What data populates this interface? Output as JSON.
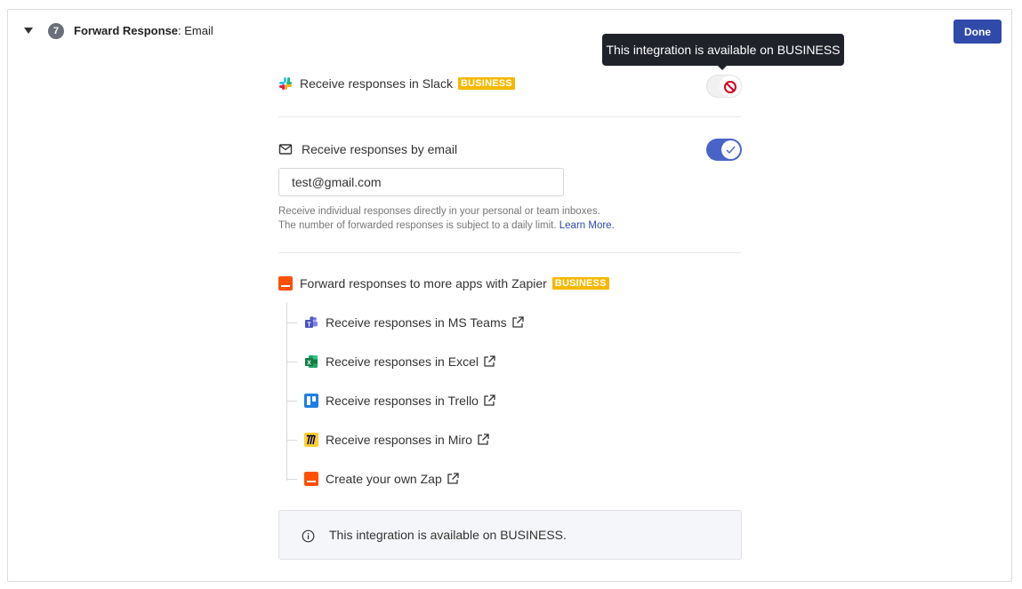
{
  "header": {
    "step_number": "7",
    "title_bold": "Forward Response",
    "title_rest": ": Email",
    "done_label": "Done"
  },
  "tooltip": {
    "text": "This integration is available on BUSINESS"
  },
  "slack": {
    "label": "Receive responses in Slack",
    "badge": "BUSINESS",
    "enabled": false
  },
  "email": {
    "label": "Receive responses by email",
    "enabled": true,
    "value": "test@gmail.com",
    "help_line1": "Receive individual responses directly in your personal or team inboxes.",
    "help_line2": "The number of forwarded responses is subject to a daily limit.",
    "learn_more": "Learn More."
  },
  "zapier": {
    "label": "Forward responses to more apps with Zapier",
    "badge": "BUSINESS",
    "items": [
      {
        "label": "Receive responses in MS Teams",
        "icon": "ms-teams-icon"
      },
      {
        "label": "Receive responses in Excel",
        "icon": "excel-icon"
      },
      {
        "label": "Receive responses in Trello",
        "icon": "trello-icon"
      },
      {
        "label": "Receive responses in Miro",
        "icon": "miro-icon"
      },
      {
        "label": "Create your own Zap",
        "icon": "zapier-icon"
      }
    ]
  },
  "info": {
    "text": "This integration is available on BUSINESS."
  },
  "colors": {
    "primary": "#2f4aa9",
    "toggle_on": "#4a63c9",
    "business_badge": "#f5b800",
    "zapier": "#ff4f00",
    "tooltip_bg": "#1f2229"
  }
}
